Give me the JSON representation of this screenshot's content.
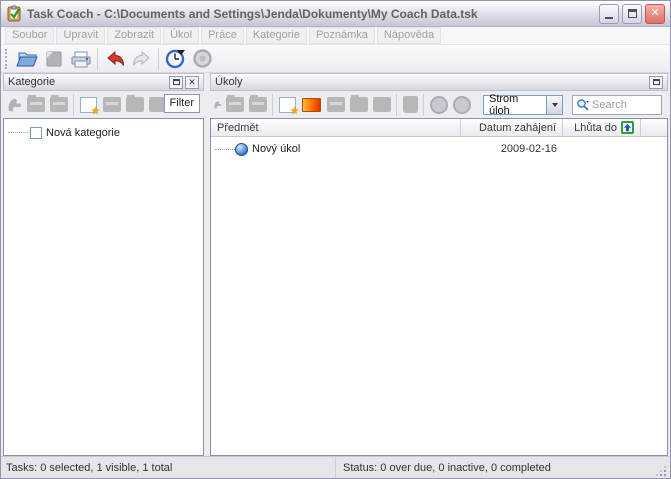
{
  "window": {
    "title": "Task Coach - C:\\Documents and Settings\\Jenda\\Dokumenty\\My Coach Data.tsk"
  },
  "menu": {
    "items": [
      "Soubor",
      "Upravit",
      "Zobrazit",
      "Úkol",
      "Práce",
      "Kategorie",
      "Poznámka",
      "Nápověda"
    ]
  },
  "main_toolbar": {
    "icons": [
      "open-file",
      "save-file-disabled",
      "print",
      "undo",
      "redo-disabled",
      "start-effort-tracking-clock",
      "stop-effort-tracking-disabled"
    ]
  },
  "categories_panel": {
    "title": "Kategorie",
    "filter_label": "Filter",
    "toolbar_icons": [
      "paste-disabled",
      "cut-disabled",
      "copy-disabled",
      "new-category",
      "new-subcategory-disabled",
      "edit-disabled",
      "delete-disabled"
    ],
    "items": [
      {
        "label": "Nová kategorie",
        "checked": false
      }
    ]
  },
  "tasks_panel": {
    "title": "Úkoly",
    "toolbar_icons": [
      "paste-disabled",
      "cut-disabled",
      "copy-disabled",
      "new-task",
      "new-task-from-template",
      "new-subtask-disabled",
      "edit-disabled",
      "delete-disabled",
      "mail-disabled",
      "start-tracking-disabled",
      "stop-tracking-disabled"
    ],
    "view_selector": {
      "value": "Strom úloh"
    },
    "search": {
      "placeholder": "Search"
    },
    "columns": [
      {
        "label": "Předmět"
      },
      {
        "label": "Datum zahájení"
      },
      {
        "label": "Lhůta do",
        "sorted": "ascending"
      }
    ],
    "rows": [
      {
        "subject": "Nový úkol",
        "start_date": "2009-02-16",
        "due_date": ""
      }
    ]
  },
  "status_bar": {
    "tasks_text": "Tasks: 0 selected, 1 visible, 1 total",
    "status_text": "Status: 0 over due, 0 inactive, 0 completed"
  },
  "icons": {
    "app": "clipboard-with-green-check",
    "close_glyph": "✕",
    "pane_close_glyph": "✕",
    "star_glyph": "★"
  },
  "colors": {
    "titlebar_close_button": "#dc7064",
    "task_sphere_blue": "#2e6fc2",
    "disabled_icon_gray": "#b7b7bb",
    "new_item_star": "#f5a800",
    "template_icon_gradient": [
      "#ffb840",
      "#e03400"
    ],
    "sort_icon_green": "#2e9e3a",
    "undo_arrow_red": "#d23b2f"
  }
}
